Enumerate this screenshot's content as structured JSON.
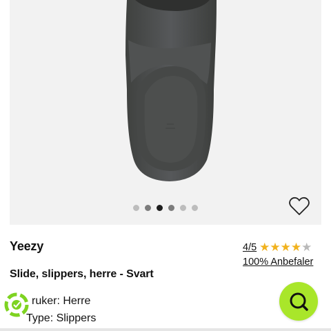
{
  "product": {
    "brand": "Yeezy",
    "title": "Slide, slippers, herre - Svart",
    "rating": {
      "score_text": "4/5",
      "value": 4,
      "max": 5
    },
    "recommend_text": "100% Anbefaler",
    "attributes": [
      {
        "label": "ruker",
        "value": "Herre"
      },
      {
        "label": "Type",
        "value": "Slippers"
      }
    ]
  },
  "gallery": {
    "image_count": 6,
    "active_index": 2
  },
  "icons": {
    "favorite": "heart-outline-icon",
    "chat": "chat-search-icon",
    "badge": "eco-recycle-icon"
  },
  "colors": {
    "star_filled": "#f1b21e",
    "star_empty": "#b9b9b9",
    "chat_accent": "#a9e62a",
    "badge_green": "#7ed321",
    "slide_color": "#4b4d4b"
  }
}
